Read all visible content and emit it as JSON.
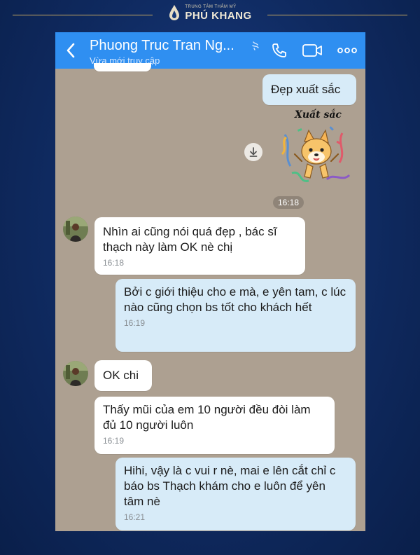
{
  "brand": {
    "small": "TRUNG TÂM THẨM MỸ",
    "name": "PHÚ KHANG"
  },
  "header": {
    "contact_name": "Phuong Truc Tran Ng...",
    "status": "Vừa mới truy cập",
    "icons": [
      "back-arrow-icon",
      "call-icon",
      "video-call-icon",
      "more-icon"
    ]
  },
  "messages": [
    {
      "dir": "out",
      "text": "Đẹp xuất sắc",
      "time": ""
    },
    {
      "dir": "out",
      "type": "sticker",
      "sticker_text": "Xuất sắc",
      "time": "16:18"
    },
    {
      "dir": "in",
      "text": "Nhìn ai cũng nói quá đẹp , bác sĩ thạch này làm OK nè chị",
      "time": "16:18"
    },
    {
      "dir": "out",
      "text": "Bởi c giới thiệu cho e mà, e yên tam, c lúc nào cũng chọn bs tốt cho khách hết",
      "time": "16:19"
    },
    {
      "dir": "in",
      "text": "OK chi",
      "time": ""
    },
    {
      "dir": "in",
      "text": "Thấy mũi của em 10 người đều đòi làm đủ 10 người luôn",
      "time": "16:19"
    },
    {
      "dir": "out",
      "text": "Hihi, vậy là c vui r nè, mai e lên cắt chỉ c báo bs Thạch khám cho e luôn để yên tâm nè",
      "time": "16:21"
    }
  ],
  "colors": {
    "header": "#2f8ff1",
    "chat_bg": "#ada091",
    "outgoing": "#d7ebf8",
    "incoming": "#ffffff",
    "brand_gold": "#c9a961"
  }
}
